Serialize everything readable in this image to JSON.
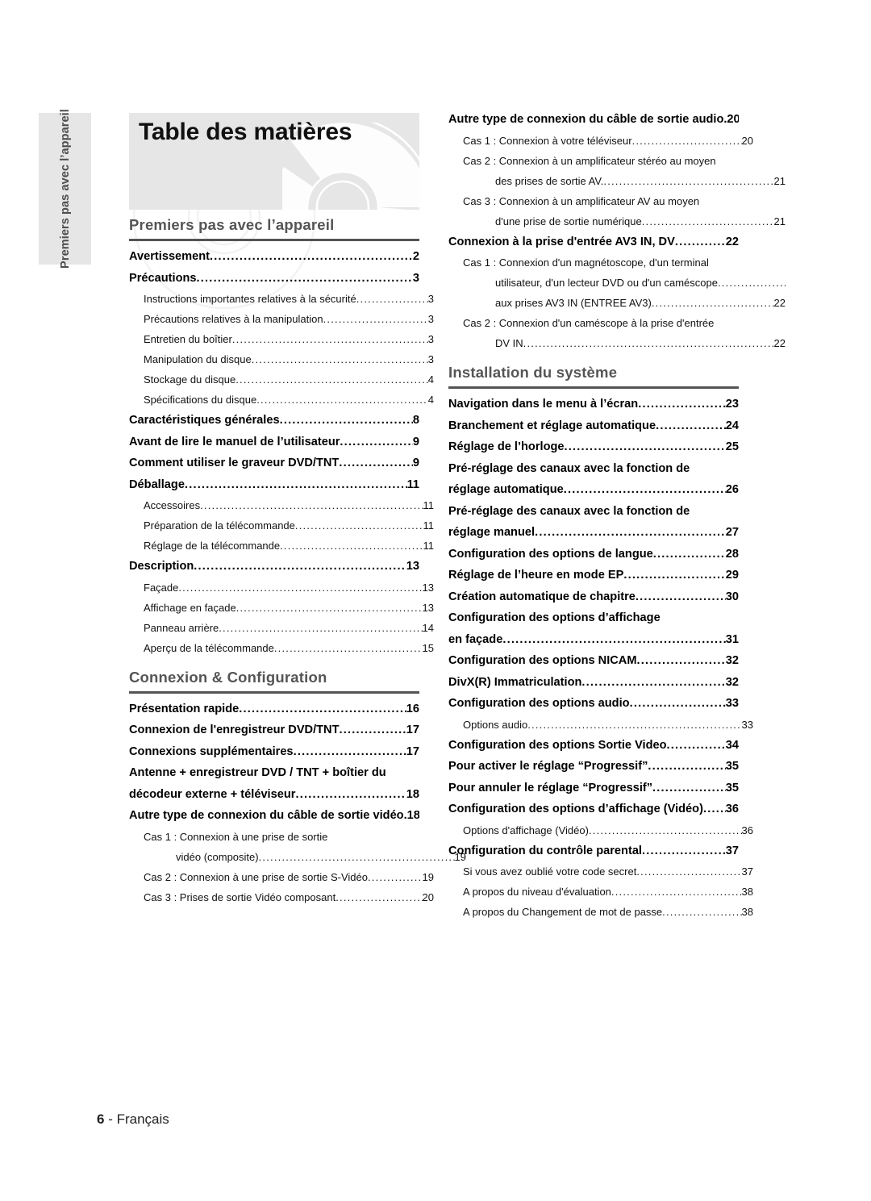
{
  "page": {
    "title": "Table des matières",
    "side_tab_label": "Premiers pas avec l’appareil",
    "footer_page_number": "6",
    "footer_separator": " - ",
    "footer_language": "Français",
    "colors": {
      "banner_bg": "#e6e6e6",
      "side_tab_bg": "#e6e6e6",
      "section_heading": "#555555",
      "section_rule": "#545454",
      "body_text": "#111111"
    }
  },
  "left_column": {
    "sections": [
      {
        "title": "Premiers pas avec l’appareil",
        "entries": [
          {
            "level": 1,
            "text": "Avertissement",
            "page": "2"
          },
          {
            "level": 1,
            "text": "Précautions",
            "page": "3"
          },
          {
            "level": 2,
            "text": "Instructions importantes relatives à la sécurité",
            "page": "3"
          },
          {
            "level": 2,
            "text": "Précautions relatives à la manipulation",
            "page": "3"
          },
          {
            "level": 2,
            "text": "Entretien du boîtier",
            "page": "3"
          },
          {
            "level": 2,
            "text": "Manipulation du disque",
            "page": "3"
          },
          {
            "level": 2,
            "text": "Stockage du disque",
            "page": "4"
          },
          {
            "level": 2,
            "text": "Spécifications du disque",
            "page": "4"
          },
          {
            "level": 1,
            "text": "Caractéristiques générales",
            "page": "8"
          },
          {
            "level": 1,
            "text": "Avant de lire le manuel de l’utilisateur",
            "page": "9"
          },
          {
            "level": 1,
            "text": "Comment utiliser le graveur DVD/TNT",
            "page": "9"
          },
          {
            "level": 1,
            "text": "Déballage",
            "page": "11"
          },
          {
            "level": 2,
            "text": "Accessoires",
            "page": "11"
          },
          {
            "level": 2,
            "text": "Préparation de la télécommande",
            "page": "11"
          },
          {
            "level": 2,
            "text": "Réglage de la télécommande",
            "page": "11"
          },
          {
            "level": 1,
            "text": "Description",
            "page": "13"
          },
          {
            "level": 2,
            "text": "Façade",
            "page": "13"
          },
          {
            "level": 2,
            "text": "Affichage en façade",
            "page": "13"
          },
          {
            "level": 2,
            "text": "Panneau arrière",
            "page": "14"
          },
          {
            "level": 2,
            "text": "Aperçu de la télécommande",
            "page": "15"
          }
        ]
      },
      {
        "title": "Connexion & Configuration",
        "entries": [
          {
            "level": 1,
            "text": "Présentation rapide",
            "page": "16"
          },
          {
            "level": 1,
            "text": "Connexion de l'enregistreur DVD/TNT",
            "page": "17"
          },
          {
            "level": 1,
            "text": "Connexions supplémentaires",
            "page": "17"
          },
          {
            "level": 1,
            "text": "Antenne + enregistreur DVD / TNT + boîtier du",
            "page": "",
            "nodots": true
          },
          {
            "level": 1,
            "text": "décodeur externe + téléviseur",
            "page": "18"
          },
          {
            "level": 1,
            "text": "Autre type de connexion du câble de sortie vidéo",
            "page": "18"
          },
          {
            "level": 2,
            "text": "Cas 1 : Connexion à une prise de sortie",
            "page": "",
            "nodots": true
          },
          {
            "level": 3,
            "text": "vidéo (composite)",
            "page": "19"
          },
          {
            "level": 2,
            "text": "Cas 2 : Connexion à une prise de sortie S-Vidéo",
            "page": "19"
          },
          {
            "level": 2,
            "text": "Cas 3 : Prises de sortie Vidéo composant",
            "page": "20"
          }
        ]
      }
    ]
  },
  "right_column": {
    "sections": [
      {
        "title": "",
        "entries": [
          {
            "level": 1,
            "text": "Autre type de connexion du câble de sortie audio",
            "page": "20"
          },
          {
            "level": 2,
            "text": "Cas 1 : Connexion à votre téléviseur",
            "page": "20"
          },
          {
            "level": 2,
            "text": "Cas 2 : Connexion à un amplificateur stéréo au moyen",
            "page": "",
            "nodots": true
          },
          {
            "level": 3,
            "text": "des prises de sortie AV.",
            "page": "21"
          },
          {
            "level": 2,
            "text": "Cas 3 : Connexion à un amplificateur AV au moyen",
            "page": "",
            "nodots": true
          },
          {
            "level": 3,
            "text": "d'une prise de sortie numérique",
            "page": "21"
          },
          {
            "level": 1,
            "text": "Connexion à la prise d'entrée AV3 IN, DV",
            "page": "22"
          },
          {
            "level": 2,
            "text": "Cas 1 : Connexion d'un magnétoscope, d'un terminal",
            "page": "",
            "nodots": true
          },
          {
            "level": 3,
            "text": "utilisateur, d'un lecteur DVD ou d'un caméscope",
            "page": "",
            "nodots": true
          },
          {
            "level": 3,
            "text": "aux prises AV3 IN (ENTREE AV3)",
            "page": "22"
          },
          {
            "level": 2,
            "text": "Cas 2 : Connexion d'un caméscope à la prise d'entrée",
            "page": "",
            "nodots": true
          },
          {
            "level": 3,
            "text": "DV IN",
            "page": "22"
          }
        ]
      },
      {
        "title": "Installation du système",
        "entries": [
          {
            "level": 1,
            "text": "Navigation dans le menu à l’écran",
            "page": "23"
          },
          {
            "level": 1,
            "text": "Branchement et réglage automatique",
            "page": "24"
          },
          {
            "level": 1,
            "text": "Réglage de l’horloge",
            "page": "25"
          },
          {
            "level": 1,
            "text": "Pré-réglage des canaux avec la fonction de",
            "page": "",
            "nodots": true
          },
          {
            "level": 1,
            "text": "réglage automatique",
            "page": "26"
          },
          {
            "level": 1,
            "text": "Pré-réglage des canaux avec la fonction de",
            "page": "",
            "nodots": true
          },
          {
            "level": 1,
            "text": "réglage manuel",
            "page": "27"
          },
          {
            "level": 1,
            "text": "Configuration des options de langue",
            "page": "28"
          },
          {
            "level": 1,
            "text": "Réglage de l’heure en mode EP",
            "page": "29"
          },
          {
            "level": 1,
            "text": "Création automatique de chapitre",
            "page": "30"
          },
          {
            "level": 1,
            "text": "Configuration des options d’affichage",
            "page": "",
            "nodots": true
          },
          {
            "level": 1,
            "text": "en façade",
            "page": "31"
          },
          {
            "level": 1,
            "text": "Configuration des options NICAM",
            "page": "32"
          },
          {
            "level": 1,
            "text": "DivX(R) Immatriculation",
            "page": "32"
          },
          {
            "level": 1,
            "text": "Configuration des options audio",
            "page": "33"
          },
          {
            "level": 2,
            "text": "Options audio",
            "page": "33"
          },
          {
            "level": 1,
            "text": "Configuration des options Sortie Video",
            "page": "34"
          },
          {
            "level": 1,
            "text": "Pour activer le réglage “Progressif”",
            "page": "35"
          },
          {
            "level": 1,
            "text": "Pour annuler le réglage “Progressif”",
            "page": "35"
          },
          {
            "level": 1,
            "text": "Configuration des options d’affichage (Vidéo)",
            "page": "36"
          },
          {
            "level": 2,
            "text": "Options d'affichage (Vidéo)",
            "page": "36"
          },
          {
            "level": 1,
            "text": "Configuration du contrôle parental",
            "page": "37"
          },
          {
            "level": 2,
            "text": "Si vous avez oublié votre code secret",
            "page": "37"
          },
          {
            "level": 2,
            "text": "A propos du niveau d'évaluation",
            "page": "38"
          },
          {
            "level": 2,
            "text": "A propos du Changement de mot de passe",
            "page": "38"
          }
        ]
      }
    ]
  }
}
